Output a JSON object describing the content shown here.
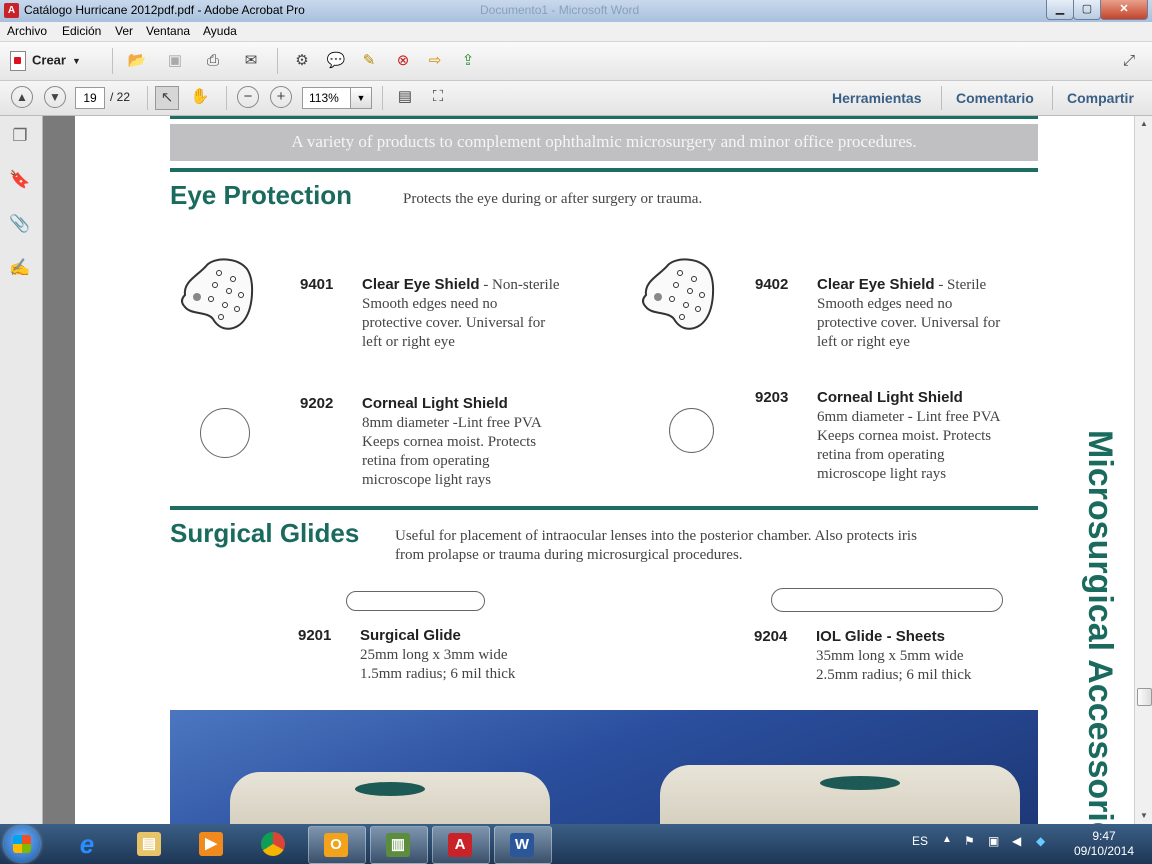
{
  "window": {
    "title": "Catálogo Hurricane 2012pdf.pdf - Adobe Acrobat Pro",
    "background_title": "Documento1 - Microsoft Word",
    "minimize": "▁",
    "maximize": "▢",
    "close": "✕"
  },
  "menu": [
    "Archivo",
    "Edición",
    "Ver",
    "Ventana",
    "Ayuda"
  ],
  "toolbar": {
    "crear_label": "Crear",
    "icons": [
      "open-icon",
      "save-icon",
      "print-icon",
      "email-icon",
      "settings-icon",
      "comment-icon",
      "edit-icon",
      "delete-icon",
      "export-icon",
      "share-icon"
    ]
  },
  "nav": {
    "page_current": "19",
    "page_total": "/ 22",
    "zoom": "113%",
    "herramientas": "Herramientas",
    "comentario": "Comentario",
    "compartir": "Compartir"
  },
  "page": {
    "banner": "A variety of products to complement ophthalmic microsurgery and minor office procedures.",
    "side_title": "Microsurgical Accessories",
    "eye_protection": {
      "title": "Eye Protection",
      "desc": "Protects the eye during or after surgery or trauma.",
      "products": [
        {
          "code": "9401",
          "name": "Clear Eye Shield",
          "note": " - Non-sterile",
          "lines": [
            "Smooth edges need no",
            "protective cover. Universal for",
            "left or right eye"
          ]
        },
        {
          "code": "9402",
          "name": "Clear Eye Shield",
          "note": " - Sterile",
          "lines": [
            "Smooth edges need no",
            "protective cover. Universal for",
            "left or right eye"
          ]
        },
        {
          "code": "9202",
          "name": "Corneal Light Shield",
          "note": "",
          "lines": [
            "8mm diameter -Lint free PVA",
            "Keeps cornea moist. Protects",
            "retina from operating",
            "microscope light rays"
          ]
        },
        {
          "code": "9203",
          "name": "Corneal Light Shield",
          "note": "",
          "lines": [
            "6mm diameter - Lint free PVA",
            "Keeps cornea moist. Protects",
            "retina from operating",
            "microscope light rays"
          ]
        }
      ]
    },
    "surgical_glides": {
      "title": "Surgical Glides",
      "desc1": "Useful for placement of intraocular lenses into the posterior chamber. Also protects iris",
      "desc2": "from prolapse or trauma during microsurgical procedures.",
      "products": [
        {
          "code": "9201",
          "name": "Surgical Glide",
          "lines": [
            "25mm long x 3mm wide",
            "1.5mm radius; 6 mil thick"
          ]
        },
        {
          "code": "9204",
          "name": "IOL Glide - Sheets",
          "lines": [
            "35mm long x 5mm wide",
            "2.5mm radius; 6 mil thick"
          ]
        }
      ]
    }
  },
  "taskbar": {
    "apps": [
      "explorer-icon",
      "internet-explorer-icon",
      "file-manager-icon",
      "media-player-icon",
      "chrome-icon",
      "outlook-icon",
      "project-icon",
      "acrobat-icon",
      "word-icon"
    ],
    "language": "ES",
    "time": "9:47",
    "date": "09/10/2014"
  }
}
